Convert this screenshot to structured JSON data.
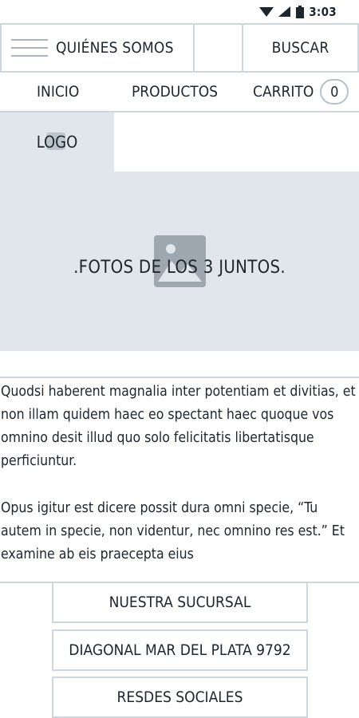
{
  "status_bar": {
    "time": "3:03",
    "icons": [
      "wifi-icon",
      "signal-icon",
      "battery-icon"
    ]
  },
  "header": {
    "menu_label": "QUIÉNES SOMOS",
    "search_label": "BUSCAR"
  },
  "nav": {
    "items": [
      {
        "label": "INICIO"
      },
      {
        "label": "PRODUCTOS"
      },
      {
        "label": "CARRITO"
      }
    ],
    "cart_count": "0"
  },
  "logo": {
    "label": "LOGO"
  },
  "hero": {
    "caption": ".FOTOS DE LOS 3 JUNTOS."
  },
  "content": {
    "paragraph_1": "Quodsi haberent magnalia inter potentiam et divitias, et non illam quidem haec eo spectant haec quoque vos omnino desit illud quo solo felicitatis libertatisque perficiuntur.",
    "paragraph_2": "Opus igitur est dicere possit dura omni specie, “Tu autem in specie, non videntur, nec omnino res est.” Et examine ab eis praecepta eius"
  },
  "footer": {
    "buttons": [
      {
        "label": "NUESTRA SUCURSAL"
      },
      {
        "label": "DIAGONAL MAR DEL PLATA 9792"
      },
      {
        "label": "RESDES SOCIALES"
      }
    ]
  },
  "colors": {
    "border": "#cfd6de",
    "placeholder_bg": "#e1e6ec",
    "text": "#1f252d"
  }
}
